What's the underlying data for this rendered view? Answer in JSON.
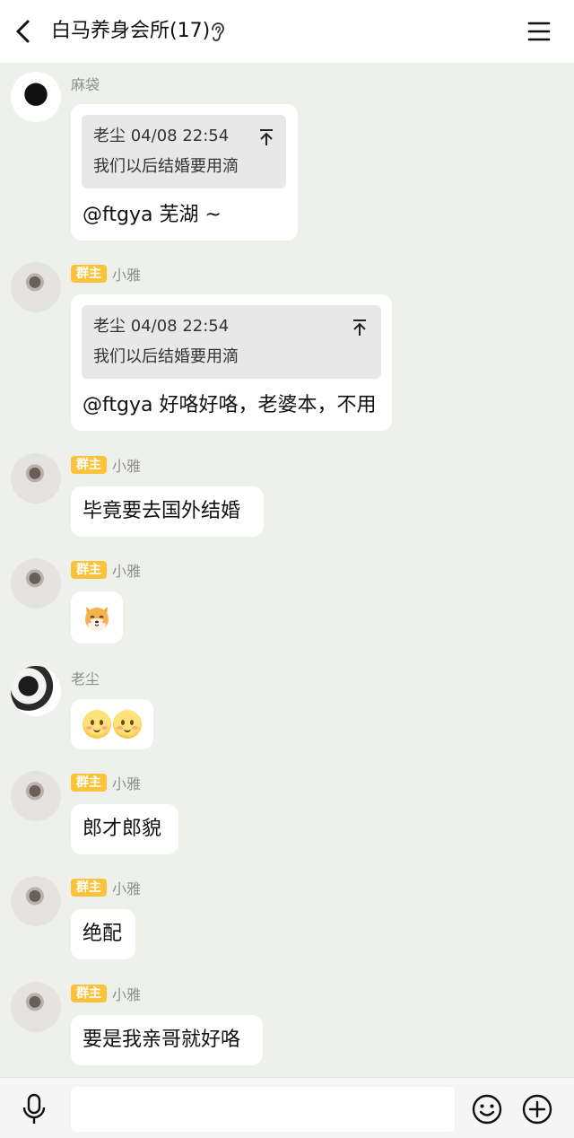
{
  "header": {
    "title": "白马养身会所(17)",
    "icons": [
      "back-arrow-icon",
      "ear-icon",
      "menu-icon"
    ]
  },
  "badge_label": "群主",
  "messages": [
    {
      "sender": "麻袋",
      "quote": {
        "author": "老尘",
        "time": "04/08 22:54",
        "text": "我们以后结婚要用滴"
      },
      "text": "@ftgya 芜湖 ~"
    },
    {
      "sender": "小雅",
      "owner": true,
      "quote": {
        "author": "老尘",
        "time": "04/08 22:54",
        "text": "我们以后结婚要用滴"
      },
      "text": "@ftgya 好咯好咯，老婆本，不用"
    },
    {
      "sender": "小雅",
      "owner": true,
      "text": "毕竟要去国外结婚"
    },
    {
      "sender": "小雅",
      "owner": true,
      "emoji": [
        "shiba-dog-emoji"
      ]
    },
    {
      "sender": "老尘",
      "emoji": [
        "blush-face-emoji",
        "blush-face-emoji"
      ]
    },
    {
      "sender": "小雅",
      "owner": true,
      "text": "郎才郎貌"
    },
    {
      "sender": "小雅",
      "owner": true,
      "text": "绝配"
    },
    {
      "sender": "小雅",
      "owner": true,
      "text": "要是我亲哥就好咯"
    }
  ],
  "input": {
    "value": "",
    "placeholder": "",
    "icons": [
      "microphone-icon",
      "emoji-icon",
      "plus-circle-icon"
    ]
  },
  "colors": {
    "background": "#eef1eb",
    "bubble": "#ffffff",
    "quote_bg": "#e8e8e8",
    "owner_badge": "#fbc23a",
    "name_text": "#8e8e8e"
  }
}
